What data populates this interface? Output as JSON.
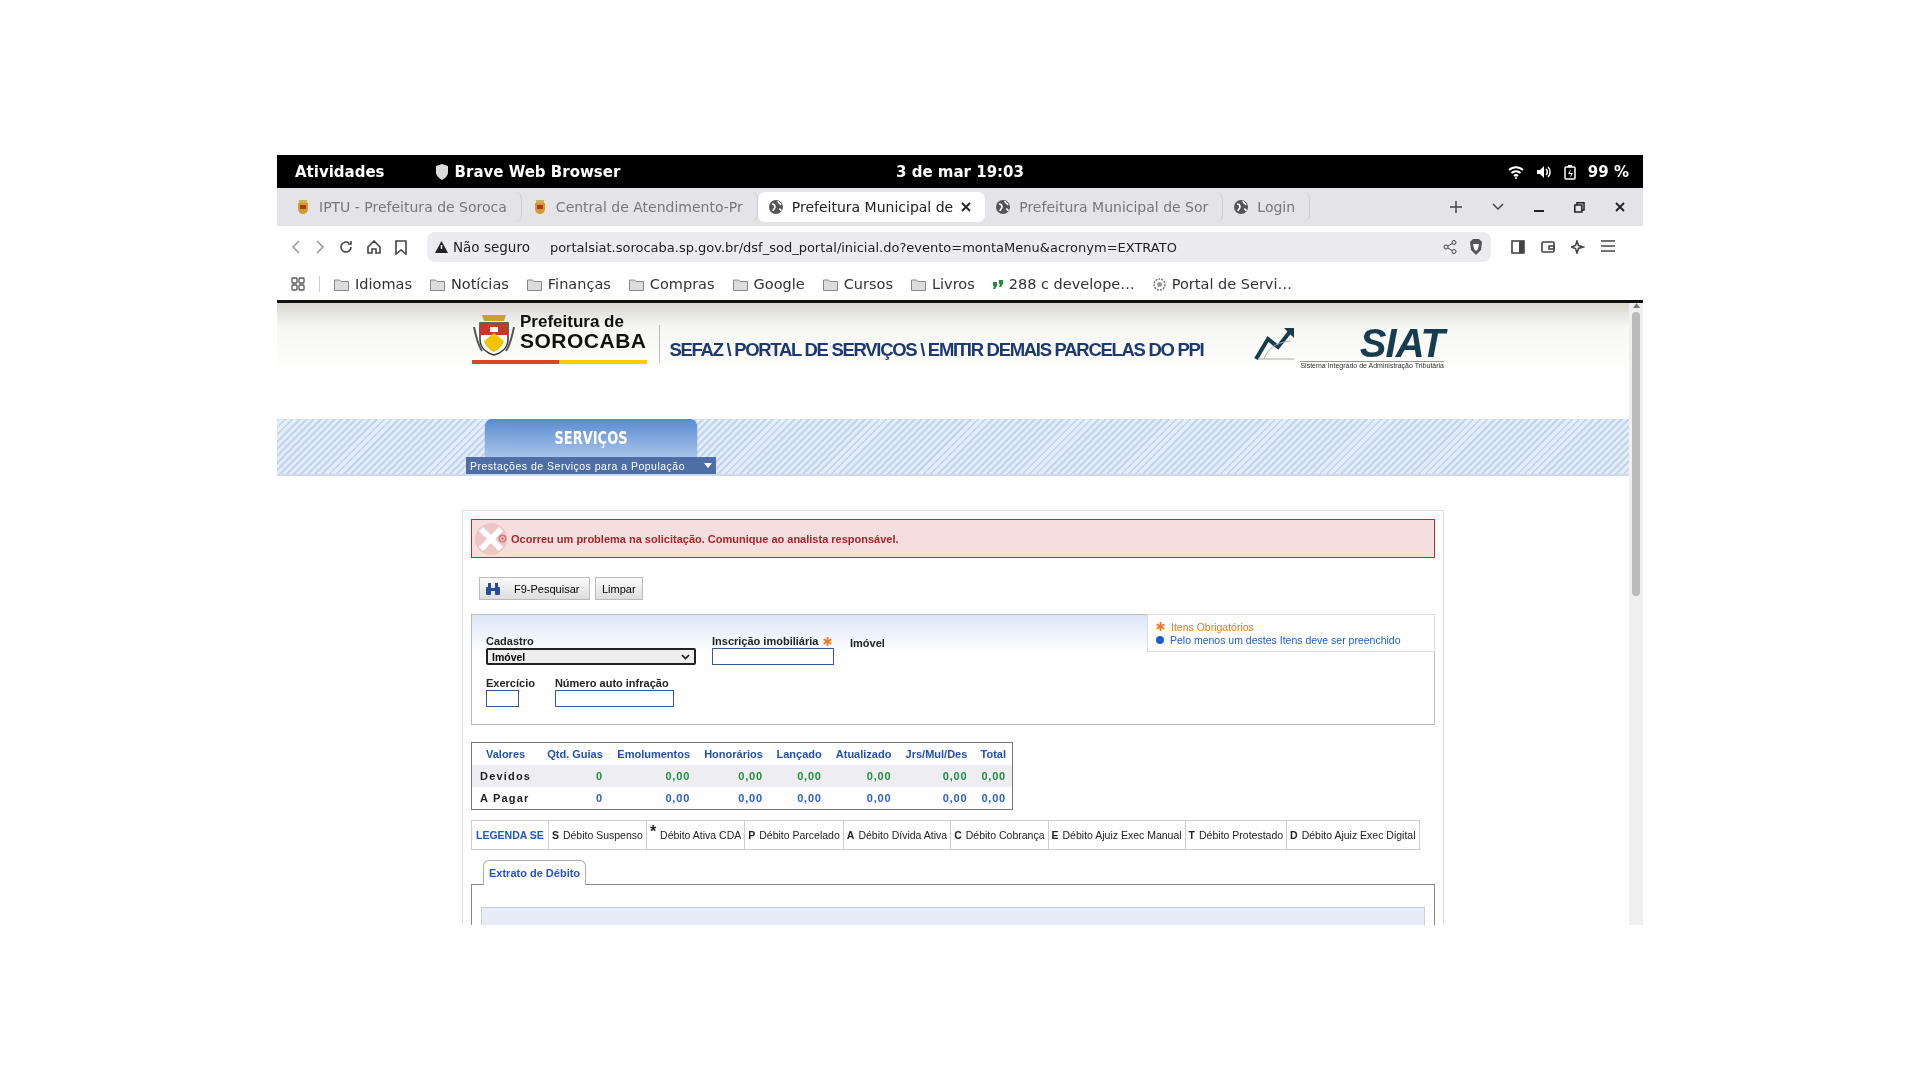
{
  "system_bar": {
    "activities": "Atividades",
    "app_name": "Brave Web Browser",
    "clock": "3 de mar  19:03",
    "battery": "99 %"
  },
  "tabs": [
    {
      "title": "IPTU - Prefeitura de Soroca",
      "kind": "crest",
      "selected": false
    },
    {
      "title": "Central de Atendimento-Pr",
      "kind": "crest",
      "selected": false
    },
    {
      "title": "Prefeitura Municipal de",
      "kind": "globe",
      "selected": true
    },
    {
      "title": "Prefeitura Municipal de Sor",
      "kind": "globe",
      "selected": false
    },
    {
      "title": "Login",
      "kind": "globe",
      "selected": false
    }
  ],
  "address_bar": {
    "security": "Não seguro",
    "url": "portalsiat.sorocaba.sp.gov.br/dsf_sod_portal/inicial.do?evento=montaMenu&acronym=EXTRATO"
  },
  "bookmarks": [
    {
      "label": "Idiomas",
      "kind": "folder"
    },
    {
      "label": "Notícias",
      "kind": "folder"
    },
    {
      "label": "Finanças",
      "kind": "folder"
    },
    {
      "label": "Compras",
      "kind": "folder"
    },
    {
      "label": "Google",
      "kind": "folder"
    },
    {
      "label": "Cursos",
      "kind": "folder"
    },
    {
      "label": "Livros",
      "kind": "folder"
    },
    {
      "label": "288 c develope…",
      "kind": "app"
    },
    {
      "label": "Portal de Servi…",
      "kind": "site"
    }
  ],
  "page": {
    "logo": {
      "line_1": "Prefeitura de",
      "line_2": "SOROCABA"
    },
    "breadcrumb": "SEFAZ \\ PORTAL DE SERVIÇOS \\ EMITIR DEMAIS PARCELAS DO PPI",
    "siat_logo": {
      "name": "SIAT",
      "tagline": "Sistema Integrado de Administração Tributária"
    },
    "menu": {
      "title": "SERVIÇOS",
      "subtitle": "Prestações de Serviços para a População"
    },
    "error": "Ocorreu um problema na solicitação. Comunique ao analista responsável.",
    "buttons": [
      {
        "label": "F9-Pesquisar",
        "kind": "search"
      },
      {
        "label": "Limpar",
        "kind": "plain"
      }
    ],
    "form": {
      "cadastro": {
        "label": "Cadastro",
        "value": "Imóvel",
        "required": false
      },
      "inscricao": {
        "label": "Inscrição imobiliária",
        "required": true
      },
      "type_label": "Imóvel",
      "exercicio": {
        "label": "Exercício",
        "required": false
      },
      "auto": {
        "label": "Número auto infração",
        "required": false
      },
      "hints": [
        {
          "text": "Itens Obrigatórios",
          "kind": "required"
        },
        {
          "text": "Pelo menos um destes Itens deve ser preenchido",
          "kind": "one_of"
        }
      ]
    },
    "summary": {
      "columns": [
        "Valores",
        "Qtd. Guias",
        "Emolumentos",
        "Honorários",
        "Lançado",
        "Atualizado",
        "Jrs/Mul/Des",
        "Total"
      ],
      "rows": [
        {
          "color": "#1e8c3c",
          "cells": [
            "Devidos",
            "0",
            "0,00",
            "0,00",
            "0,00",
            "0,00",
            "0,00",
            "0,00"
          ]
        },
        {
          "color": "#2a5fd0",
          "cells": [
            "A Pagar",
            "0",
            "0,00",
            "0,00",
            "0,00",
            "0,00",
            "0,00",
            "0,00"
          ]
        }
      ]
    },
    "legend": {
      "title": "LEGENDA SE",
      "items": [
        {
          "code": "S",
          "text": "Débito Suspenso"
        },
        {
          "code": "*",
          "text": "Débito Ativa CDA"
        },
        {
          "code": "P",
          "text": "Débito Parcelado"
        },
        {
          "code": "A",
          "text": "Débito Dívida Ativa"
        },
        {
          "code": "C",
          "text": "Débito Cobrança"
        },
        {
          "code": "E",
          "text": "Débito Ajuiz Exec Manual"
        },
        {
          "code": "T",
          "text": "Débito Protestado"
        },
        {
          "code": "D",
          "text": "Débito Ajuiz Exec Digital"
        }
      ]
    },
    "result_tabs": [
      {
        "label": "Extrato de Débito",
        "selected": true
      }
    ]
  }
}
